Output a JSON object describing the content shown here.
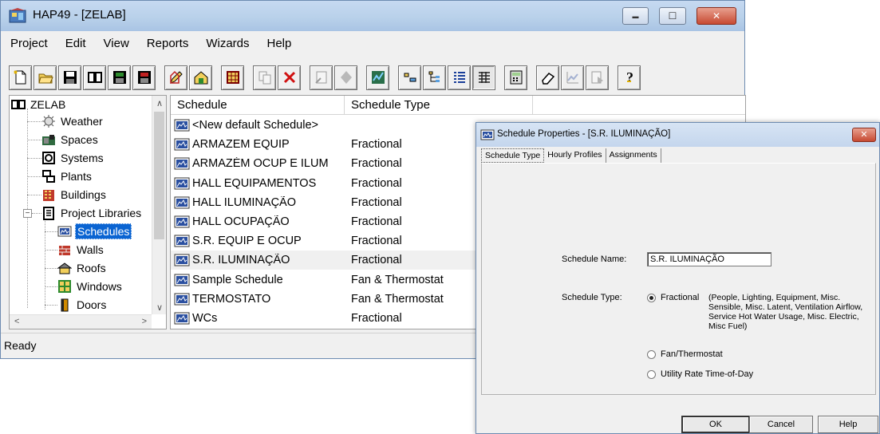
{
  "main_window": {
    "title": "HAP49 - [ZELAB]",
    "controls": {
      "minimize": "▬",
      "maximize": "☐",
      "close": "✕"
    },
    "menu": [
      "Project",
      "Edit",
      "View",
      "Reports",
      "Wizards",
      "Help"
    ],
    "toolbar_icons": [
      "new-project-icon",
      "open-project-icon",
      "save-project-icon",
      "library-icon",
      "archive-icon",
      "retrieve-icon",
      "separator",
      "edit-icon",
      "home-icon",
      "separator",
      "grid-icon",
      "separator",
      "copy-icon",
      "delete-icon",
      "separator",
      "wizard-icon",
      "diamond-icon",
      "separator",
      "calculate-icon",
      "separator",
      "small-icons-icon",
      "tree-icon",
      "list-view-icon",
      "details-view-icon",
      "separator",
      "calculator-icon",
      "separator",
      "eraser-icon",
      "chart-icon",
      "report-icon",
      "separator",
      "help-icon"
    ],
    "status": "Ready"
  },
  "tree": {
    "root": "ZELAB",
    "items": [
      {
        "label": "Weather",
        "icon": "weather-icon"
      },
      {
        "label": "Spaces",
        "icon": "spaces-icon"
      },
      {
        "label": "Systems",
        "icon": "systems-icon"
      },
      {
        "label": "Plants",
        "icon": "plants-icon"
      },
      {
        "label": "Buildings",
        "icon": "buildings-icon"
      },
      {
        "label": "Project Libraries",
        "icon": "library-book-icon"
      },
      {
        "label": "Schedules",
        "icon": "schedule-icon"
      },
      {
        "label": "Walls",
        "icon": "wall-icon"
      },
      {
        "label": "Roofs",
        "icon": "roof-icon"
      },
      {
        "label": "Windows",
        "icon": "window-icon"
      },
      {
        "label": "Doors",
        "icon": "door-icon"
      }
    ],
    "selected": "Schedules"
  },
  "list": {
    "columns": [
      "Schedule",
      "Schedule Type"
    ],
    "rows": [
      {
        "name": "<New default Schedule>",
        "type": ""
      },
      {
        "name": "ARMAZEM EQUIP",
        "type": "Fractional"
      },
      {
        "name": "ARMAZÉM OCUP E ILUM",
        "type": "Fractional"
      },
      {
        "name": "HALL EQUIPAMENTOS",
        "type": "Fractional"
      },
      {
        "name": "HALL ILUMINAÇÃO",
        "type": "Fractional"
      },
      {
        "name": "HALL OCUPAÇÃO",
        "type": "Fractional"
      },
      {
        "name": "S.R. EQUIP E OCUP",
        "type": "Fractional"
      },
      {
        "name": "S.R. ILUMINAÇÃO",
        "type": "Fractional"
      },
      {
        "name": "Sample Schedule",
        "type": "Fan & Thermostat"
      },
      {
        "name": "TERMOSTATO",
        "type": "Fan & Thermostat"
      },
      {
        "name": "WCs",
        "type": "Fractional"
      }
    ],
    "highlighted_row": "S.R. ILUMINAÇÃO"
  },
  "dialog": {
    "title": "Schedule Properties - [S.R. ILUMINAÇÃO]",
    "close": "✕",
    "tabs": [
      "Schedule Type",
      "Hourly Profiles",
      "Assignments"
    ],
    "active_tab": "Schedule Type",
    "schedule_name_label": "Schedule Name:",
    "schedule_name_value": "S.R. ILUMINAÇÃO",
    "schedule_type_label": "Schedule Type:",
    "options": [
      {
        "label": "Fractional",
        "checked": true,
        "description": "(People, Lighting, Equipment, Misc. Sensible, Misc. Latent, Ventilation Airflow, Service Hot Water Usage, Misc. Electric, Misc Fuel)"
      },
      {
        "label": "Fan/Thermostat",
        "checked": false
      },
      {
        "label": "Utility Rate Time-of-Day",
        "checked": false
      }
    ],
    "buttons": {
      "ok": "OK",
      "cancel": "Cancel",
      "help": "Help"
    }
  }
}
